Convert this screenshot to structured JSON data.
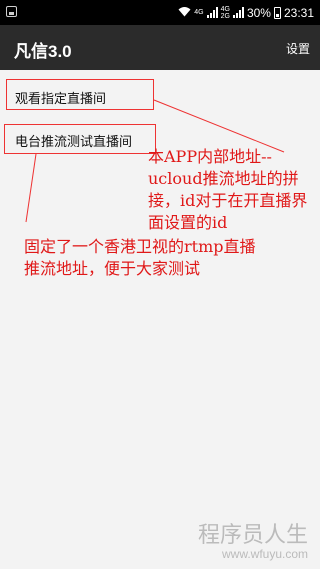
{
  "status_bar": {
    "network_1": "4G",
    "network_2": "4G",
    "network_2_sub": "2G",
    "battery": "30%",
    "time": "23:31"
  },
  "app_bar": {
    "title": "凡信3.0",
    "settings_label": "设置"
  },
  "menu": {
    "items": [
      {
        "label": "观看指定直播间"
      },
      {
        "label": "电台推流测试直播间"
      }
    ]
  },
  "annotations": {
    "note1": "本APP内部地址--ucloud推流地址的拼接，id对于在开直播界面设置的id",
    "note2": "固定了一个香港卫视的rtmp直播推流地址，便于大家测试"
  },
  "watermark": {
    "text": "程序员人生",
    "url": "www.wfuyu.com"
  },
  "colors": {
    "status_bar": "#000000",
    "app_bar": "#2b2b2b",
    "background": "#f3f3f3",
    "annotation": "#e01818"
  }
}
